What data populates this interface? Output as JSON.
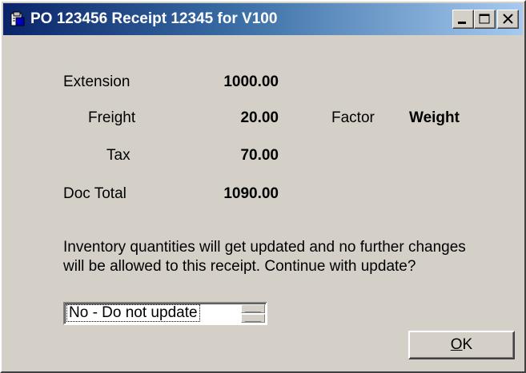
{
  "window": {
    "title": "PO 123456  Receipt 12345 for V100",
    "icon": "app-icon",
    "controls": [
      "minimize-icon",
      "maximize-icon",
      "close-icon"
    ]
  },
  "summary": {
    "extension_label": "Extension",
    "extension_value": "1000.00",
    "freight_label": "Freight",
    "freight_value": "20.00",
    "factor_label": "Factor",
    "factor_value": "Weight",
    "tax_label": "Tax",
    "tax_value": "70.00",
    "doc_total_label": "Doc Total",
    "doc_total_value": "1090.00"
  },
  "message": {
    "line1": "Inventory quantities will get updated and no further changes",
    "line2": "will be allowed to this receipt.  Continue with update?"
  },
  "update_choice": {
    "selected": "No - Do not update"
  },
  "ok_button": {
    "mnemonic": "O",
    "rest": "K"
  }
}
